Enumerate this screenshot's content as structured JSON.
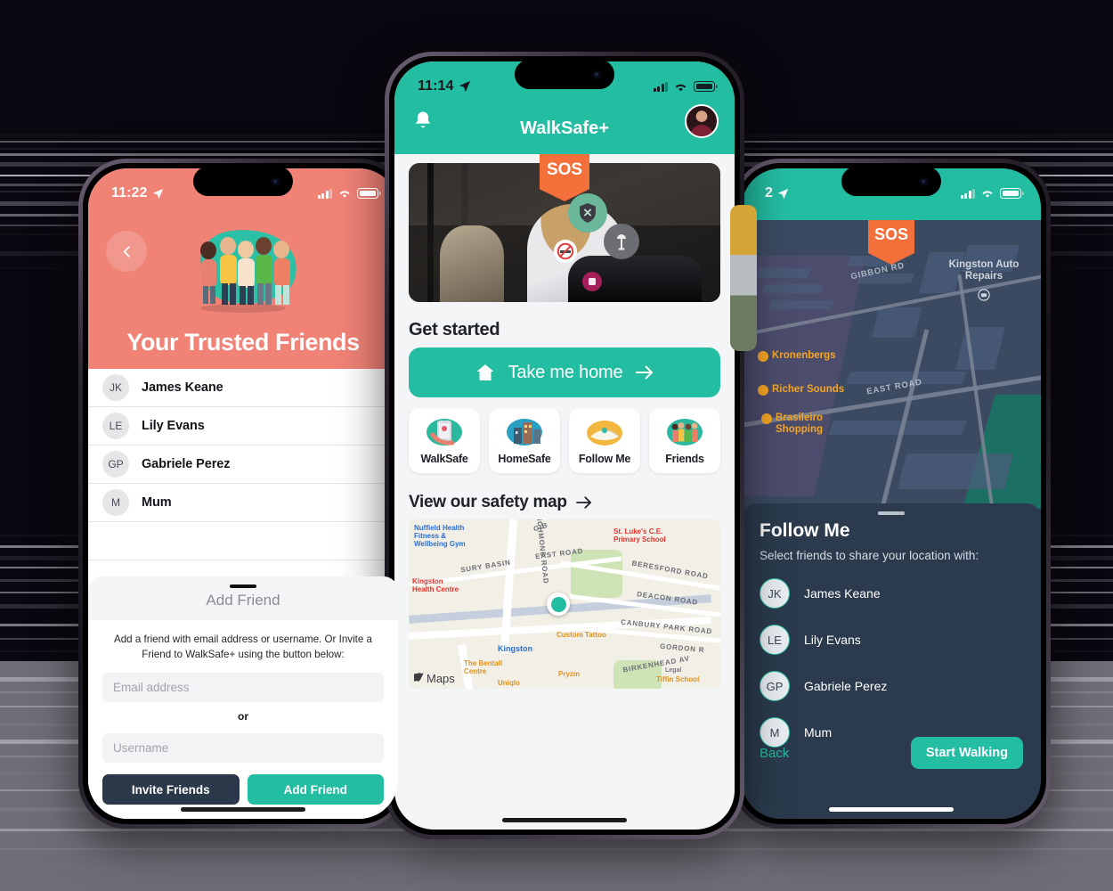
{
  "background": {
    "color": "#0b0710"
  },
  "theme": {
    "teal": "#23bda2",
    "coral": "#f08276",
    "orange": "#f4703a",
    "dark_navy": "#2b3b4d",
    "button_dark": "#2b3849"
  },
  "left_phone": {
    "status": {
      "time": "11:22",
      "location_icon": "location-arrow-icon",
      "signal_icon": "cellular-bars-icon",
      "wifi_icon": "wifi-icon",
      "battery_icon": "battery-icon"
    },
    "back_icon": "chevron-left-icon",
    "illustration": "group-of-friends-illustration",
    "title": "Your Trusted Friends",
    "friends": [
      {
        "initials": "JK",
        "name": "James Keane",
        "remove_icon": "close-circle-icon"
      },
      {
        "initials": "LE",
        "name": "Lily Evans",
        "remove_icon": "close-circle-icon"
      },
      {
        "initials": "GP",
        "name": "Gabriele Perez",
        "remove_icon": "close-circle-icon"
      },
      {
        "initials": "M",
        "name": "Mum",
        "remove_icon": "close-circle-icon"
      }
    ],
    "sheet": {
      "title": "Add Friend",
      "description": "Add a friend with email address or username. Or Invite a Friend to WalkSafe+ using the button below:",
      "email_placeholder": "Email address",
      "divider_label": "or",
      "username_placeholder": "Username",
      "invite_button": "Invite Friends",
      "add_button": "Add Friend"
    }
  },
  "center_phone": {
    "status": {
      "time": "11:14",
      "location_icon": "location-arrow-icon",
      "signal_icon": "cellular-bars-icon",
      "wifi_icon": "wifi-icon",
      "battery_icon": "battery-icon"
    },
    "header": {
      "title": "WalkSafe+",
      "bell_icon": "bell-icon",
      "avatar": "user-avatar"
    },
    "hero": {
      "sos_label": "SOS",
      "badges": [
        "shield-x-icon",
        "street-lamp-icon",
        "no-smoking-icon",
        "alert-icon"
      ],
      "image": "woman-walking-with-phone-photo"
    },
    "get_started": {
      "heading": "Get started",
      "cta_label": "Take me home",
      "cta_home_icon": "home-icon",
      "cta_arrow_icon": "arrow-right-icon",
      "tiles": [
        {
          "label": "WalkSafe",
          "icon": "phone-map-illustration"
        },
        {
          "label": "HomeSafe",
          "icon": "city-buildings-illustration"
        },
        {
          "label": "Follow Me",
          "icon": "open-map-illustration"
        },
        {
          "label": "Friends",
          "icon": "friends-group-illustration"
        }
      ]
    },
    "safety_map": {
      "heading": "View our safety map",
      "arrow_icon": "arrow-right-icon",
      "attribution": "Maps",
      "apple_icon": "apple-logo-icon",
      "labels": [
        {
          "text": "Nuffield Health Fitness & Wellbeing Gym",
          "color": "#2b6fd6"
        },
        {
          "text": "Kingston Health Centre",
          "color": "#e2342f"
        },
        {
          "text": "St. Luke's C.E. Primary School",
          "color": "#e2342f"
        },
        {
          "text": "Custom Tattoo",
          "color": "#e0921f"
        },
        {
          "text": "Kingston",
          "color": "#2b6fd6"
        },
        {
          "text": "The Bentall Centre",
          "color": "#e0921f"
        },
        {
          "text": "Uniqlo",
          "color": "#e0921f"
        },
        {
          "text": "Pryzm",
          "color": "#e0921f"
        },
        {
          "text": "Tiffin School",
          "color": "#e0921f"
        },
        {
          "text": "Legal",
          "color": "#7a7a80"
        }
      ],
      "streets": [
        "RICHMOND ROAD",
        "EAST ROAD",
        "SURY BASIN",
        "BERESFORD ROAD",
        "DEACON ROAD",
        "CANBURY PARK ROAD",
        "GORDON R",
        "BIRKENHEAD AV",
        "GIB"
      ]
    }
  },
  "right_phone": {
    "status": {
      "time": "2",
      "location_icon": "location-arrow-icon",
      "signal_icon": "cellular-bars-icon",
      "wifi_icon": "wifi-icon",
      "battery_icon": "battery-icon"
    },
    "sos_label": "SOS",
    "map_labels": [
      {
        "text": "Kingston Auto Repairs",
        "style": "grey",
        "icon": "car-repair-icon"
      },
      {
        "text": "Kronenbergs",
        "style": "orange",
        "icon": "shop-icon"
      },
      {
        "text": "Richer Sounds",
        "style": "orange",
        "icon": "shop-icon"
      },
      {
        "text": "Brasileiro Shopping",
        "style": "orange",
        "icon": "shop-icon"
      }
    ],
    "map_streets": [
      "GIBBON RD",
      "EAST ROAD"
    ],
    "panel": {
      "title": "Follow Me",
      "subtitle": "Select friends to share your location with:",
      "friends": [
        {
          "initials": "JK",
          "name": "James Keane"
        },
        {
          "initials": "LE",
          "name": "Lily Evans"
        },
        {
          "initials": "GP",
          "name": "Gabriele Perez"
        },
        {
          "initials": "M",
          "name": "Mum"
        }
      ],
      "back_label": "Back",
      "start_label": "Start Walking"
    }
  }
}
